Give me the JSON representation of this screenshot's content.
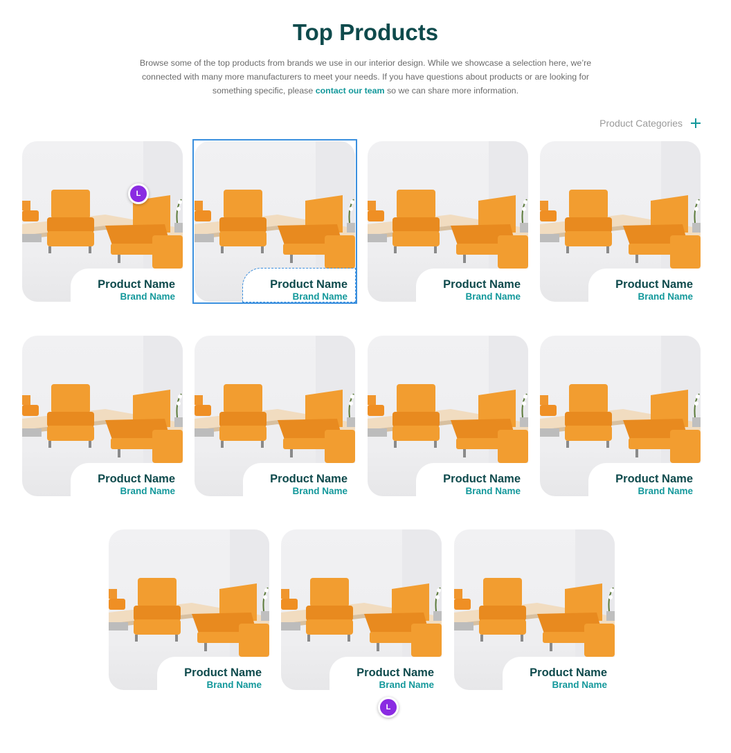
{
  "section": {
    "title": "Top Products",
    "intro_before": "Browse some of the top products from brands we use in our interior design. While we showcase a selection here, we’re connected with many more manufacturers to meet your needs. If you have questions about products or are looking for something specific, please ",
    "intro_link": "contact our team",
    "intro_after": " so we can share more information."
  },
  "filters": {
    "categories_label": "Product Categories",
    "expand_icon": "plus-icon"
  },
  "products": [
    {
      "name": "Product Name",
      "brand": "Brand Name"
    },
    {
      "name": "Product Name",
      "brand": "Brand Name"
    },
    {
      "name": "Product Name",
      "brand": "Brand Name"
    },
    {
      "name": "Product Name",
      "brand": "Brand Name"
    },
    {
      "name": "Product Name",
      "brand": "Brand Name"
    },
    {
      "name": "Product Name",
      "brand": "Brand Name"
    },
    {
      "name": "Product Name",
      "brand": "Brand Name"
    },
    {
      "name": "Product Name",
      "brand": "Brand Name"
    },
    {
      "name": "Product Name",
      "brand": "Brand Name"
    },
    {
      "name": "Product Name",
      "brand": "Brand Name"
    },
    {
      "name": "Product Name",
      "brand": "Brand Name"
    }
  ],
  "avatars": [
    {
      "initial": "L"
    },
    {
      "initial": "L"
    }
  ],
  "colors": {
    "heading": "#0e4a4c",
    "accent": "#13989b",
    "avatar": "#8a2be2",
    "selection": "#3a8fde"
  }
}
